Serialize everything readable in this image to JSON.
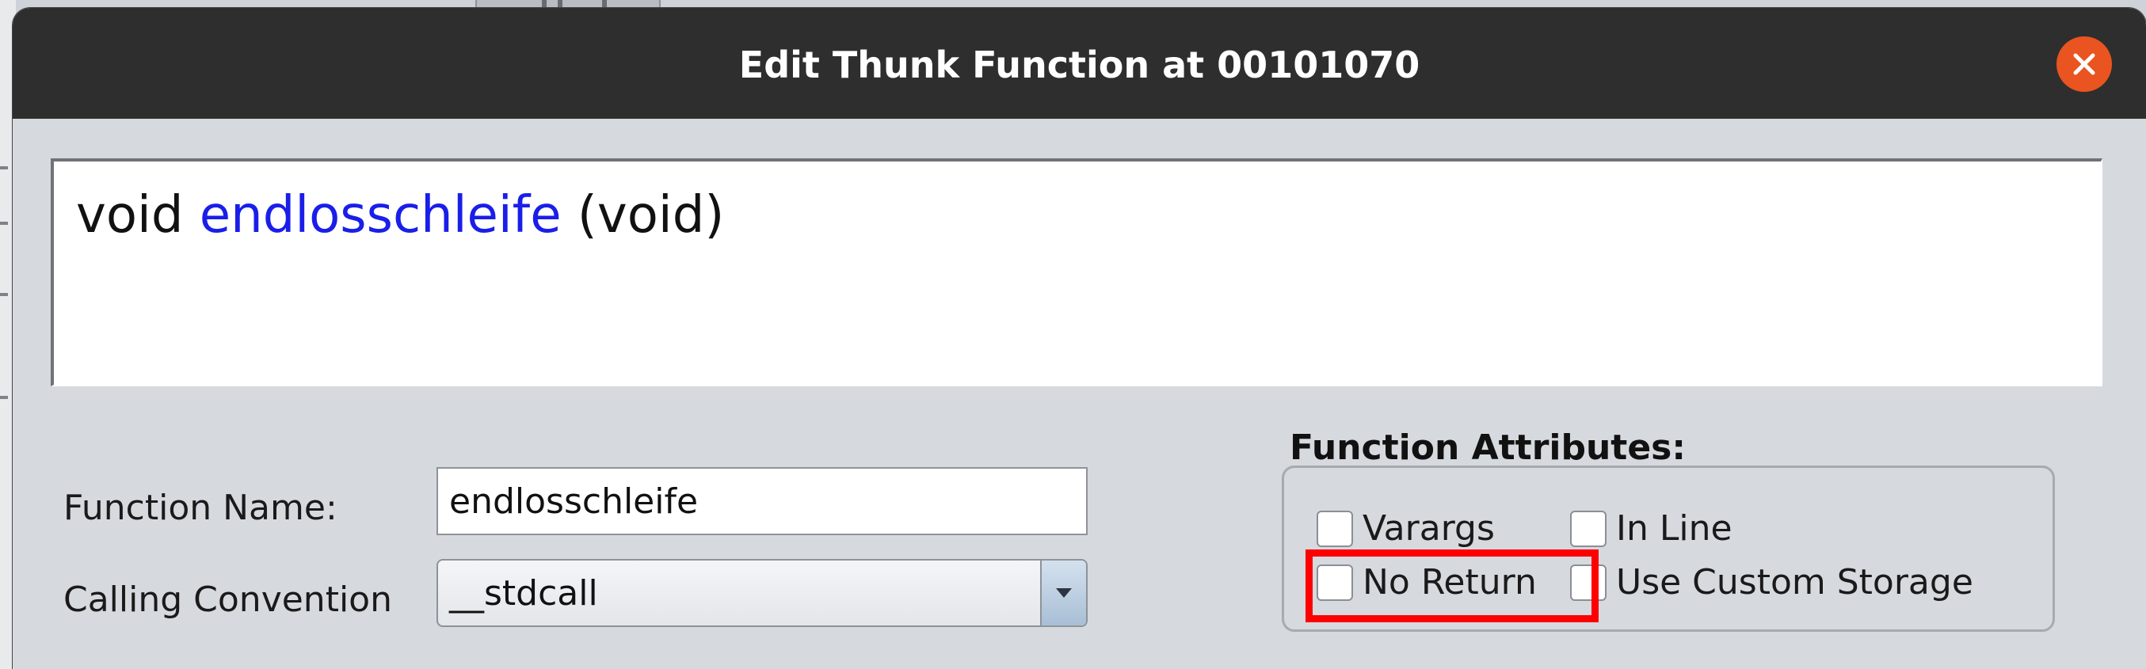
{
  "dialog": {
    "title": "Edit Thunk Function at 00101070"
  },
  "signature": {
    "return_type": "void",
    "function_name": "endlosschleife",
    "params": "(void)",
    "name_color": "#1a1ee8"
  },
  "fields": {
    "function_name_label": "Function Name:",
    "function_name_value": "endlosschleife",
    "calling_convention_label": "Calling Convention",
    "calling_convention_value": "__stdcall"
  },
  "attributes": {
    "title": "Function Attributes:",
    "varargs": {
      "label": "Varargs",
      "checked": false
    },
    "in_line": {
      "label": "In Line",
      "checked": false
    },
    "no_return": {
      "label": "No Return",
      "checked": false
    },
    "use_custom_storage": {
      "label": "Use Custom Storage",
      "checked": false
    }
  },
  "icons": {
    "close": "close-icon",
    "dropdown": "chevron-down-icon"
  },
  "colors": {
    "titlebar": "#2e2e2e",
    "close_button": "#e95420",
    "highlight": "#ff0000"
  }
}
